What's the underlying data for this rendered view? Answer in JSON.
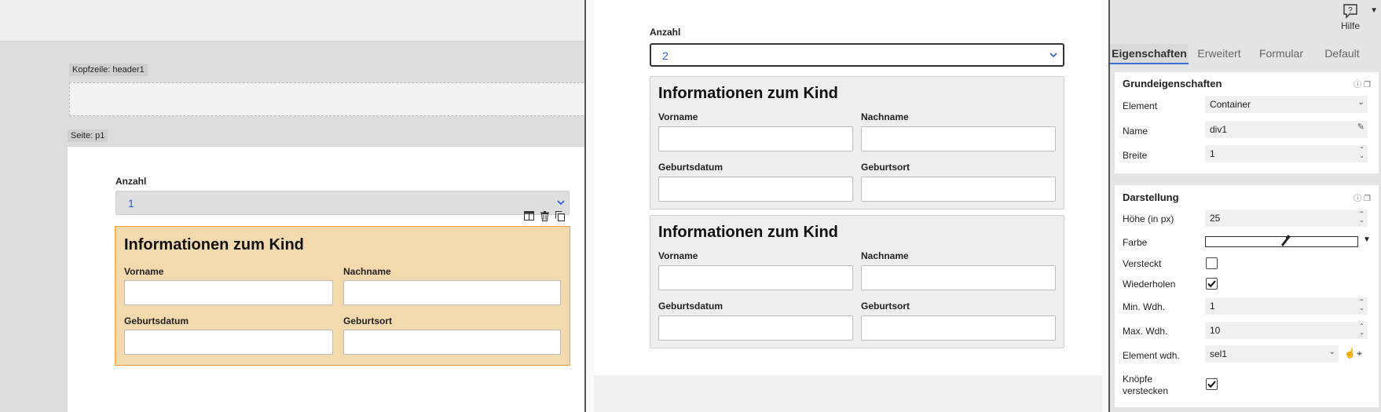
{
  "designer": {
    "header_tag": "Kopfzeile: header1",
    "page_tag": "Seite: p1",
    "count_label": "Anzahl",
    "count_value": "1",
    "box": {
      "title": "Informationen zum Kind",
      "first_name": "Vorname",
      "last_name": "Nachname",
      "birth_date": "Geburtsdatum",
      "birth_place": "Geburtsort"
    },
    "tools": [
      "layout-icon",
      "trash-icon",
      "copy-icon"
    ]
  },
  "preview": {
    "count_label": "Anzahl",
    "count_value": "2",
    "cards": [
      {
        "title": "Informationen zum Kind",
        "first_name": "Vorname",
        "last_name": "Nachname",
        "birth_date": "Geburtsdatum",
        "birth_place": "Geburtsort"
      },
      {
        "title": "Informationen zum Kind",
        "first_name": "Vorname",
        "last_name": "Nachname",
        "birth_date": "Geburtsdatum",
        "birth_place": "Geburtsort"
      }
    ]
  },
  "panel": {
    "help_label": "Hilfe",
    "tabs": [
      "Eigenschaften",
      "Erweitert",
      "Formular",
      "Default"
    ],
    "active_tab": "Eigenschaften",
    "basic": {
      "title": "Grundeigenschaften",
      "element_label": "Element",
      "element_value": "Container",
      "name_label": "Name",
      "name_value": "div1",
      "width_label": "Breite",
      "width_value": "1"
    },
    "display": {
      "title": "Darstellung",
      "height_label": "Höhe (in px)",
      "height_value": "25",
      "color_label": "Farbe",
      "hidden_label": "Versteckt",
      "hidden_checked": false,
      "repeat_label": "Wiederholen",
      "repeat_checked": true,
      "min_label": "Min. Wdh.",
      "min_value": "1",
      "max_label": "Max. Wdh.",
      "max_value": "10",
      "elem_rep_label": "Element wdh.",
      "elem_rep_value": "sel1",
      "hide_buttons_label_1": "Knöpfe",
      "hide_buttons_label_2": "verstecken",
      "hide_buttons_checked": true
    }
  }
}
